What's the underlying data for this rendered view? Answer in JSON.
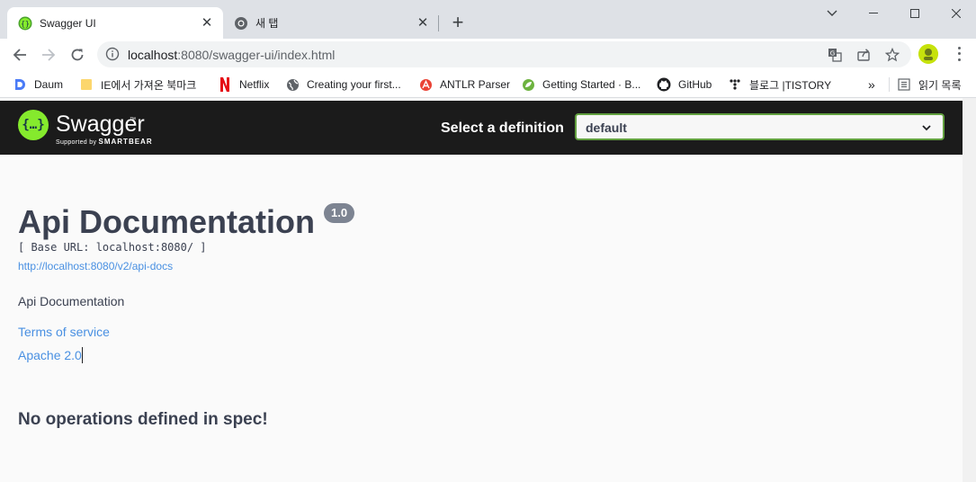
{
  "browser": {
    "tabs": [
      {
        "title": "Swagger UI",
        "close": "✕",
        "icon": "swagger-favicon",
        "active": true
      },
      {
        "title": "새 탭",
        "close": "✕",
        "icon": "chrome-icon",
        "active": false
      }
    ],
    "new_tab": "+",
    "address": {
      "host": "localhost",
      "rest": ":8080/swagger-ui/index.html"
    },
    "bookmarks": [
      {
        "label": "Daum",
        "icon": "daum-icon"
      },
      {
        "label": "IE에서 가져온 북마크",
        "icon": "folder-icon"
      },
      {
        "label": "Netflix",
        "icon": "netflix-icon"
      },
      {
        "label": "Creating your first...",
        "icon": "globe-icon"
      },
      {
        "label": "ANTLR Parser",
        "icon": "antlr-icon"
      },
      {
        "label": "Getting Started · B...",
        "icon": "spring-icon"
      },
      {
        "label": "GitHub",
        "icon": "github-icon"
      },
      {
        "label": "블로그 |TISTORY",
        "icon": "tistory-icon"
      }
    ],
    "more_bookmarks": "»",
    "reading_list": "읽기 목록"
  },
  "swagger": {
    "brand": "Swagger",
    "logo_glyph": "{…}",
    "tagline_prefix": "Supported by",
    "tagline_brand": "SMARTBEAR",
    "definition_label": "Select a definition",
    "definition_value": "default",
    "title": "Api Documentation",
    "version": "1.0",
    "base_url": "[ Base URL: localhost:8080/ ]",
    "docs_link": "http://localhost:8080/v2/api-docs",
    "description": "Api Documentation",
    "terms": "Terms of service",
    "license": "Apache 2.0",
    "no_operations": "No operations defined in spec!"
  },
  "colors": {
    "swagger_green": "#85ea2d",
    "topbar": "#1b1b1b",
    "link": "#4990e2",
    "text": "#3b4151",
    "select_border": "#62a03f"
  }
}
